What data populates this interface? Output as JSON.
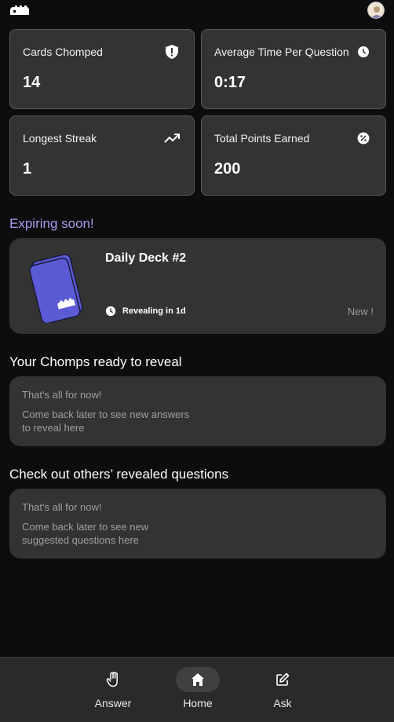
{
  "header": {
    "logo_icon": "chomp-logo-icon",
    "avatar_icon": "user-avatar"
  },
  "stats": [
    {
      "label": "Cards Chomped",
      "value": "14",
      "icon": "shield-alert-icon"
    },
    {
      "label": "Average Time Per Question",
      "value": "0:17",
      "icon": "clock-icon"
    },
    {
      "label": "Longest Streak",
      "value": "1",
      "icon": "trending-up-icon"
    },
    {
      "label": "Total Points Earned",
      "value": "200",
      "icon": "percent-icon"
    }
  ],
  "expiring": {
    "title": "Expiring soon!",
    "deck_title": "Daily Deck #2",
    "reveal_text": "Revealing in 1d",
    "new_badge": "New !",
    "accent_color": "#5b5bd6"
  },
  "chomps_ready": {
    "title": "Your Chomps ready to reveal",
    "line1": "That's all for now!",
    "line2": "Come back later to see new answers to reveal here"
  },
  "others_revealed": {
    "title": "Check out others’ revealed questions",
    "line1": "That's all for now!",
    "line2": "Come back later to see new suggested questions here"
  },
  "nav": {
    "items": [
      {
        "label": "Answer",
        "icon": "hand-icon"
      },
      {
        "label": "Home",
        "icon": "home-icon",
        "active": true
      },
      {
        "label": "Ask",
        "icon": "edit-icon"
      }
    ]
  },
  "colors": {
    "background": "#0d0d0d",
    "card": "#333333",
    "accent_text": "#a99bf2",
    "deck_purple": "#5b5bd6"
  }
}
